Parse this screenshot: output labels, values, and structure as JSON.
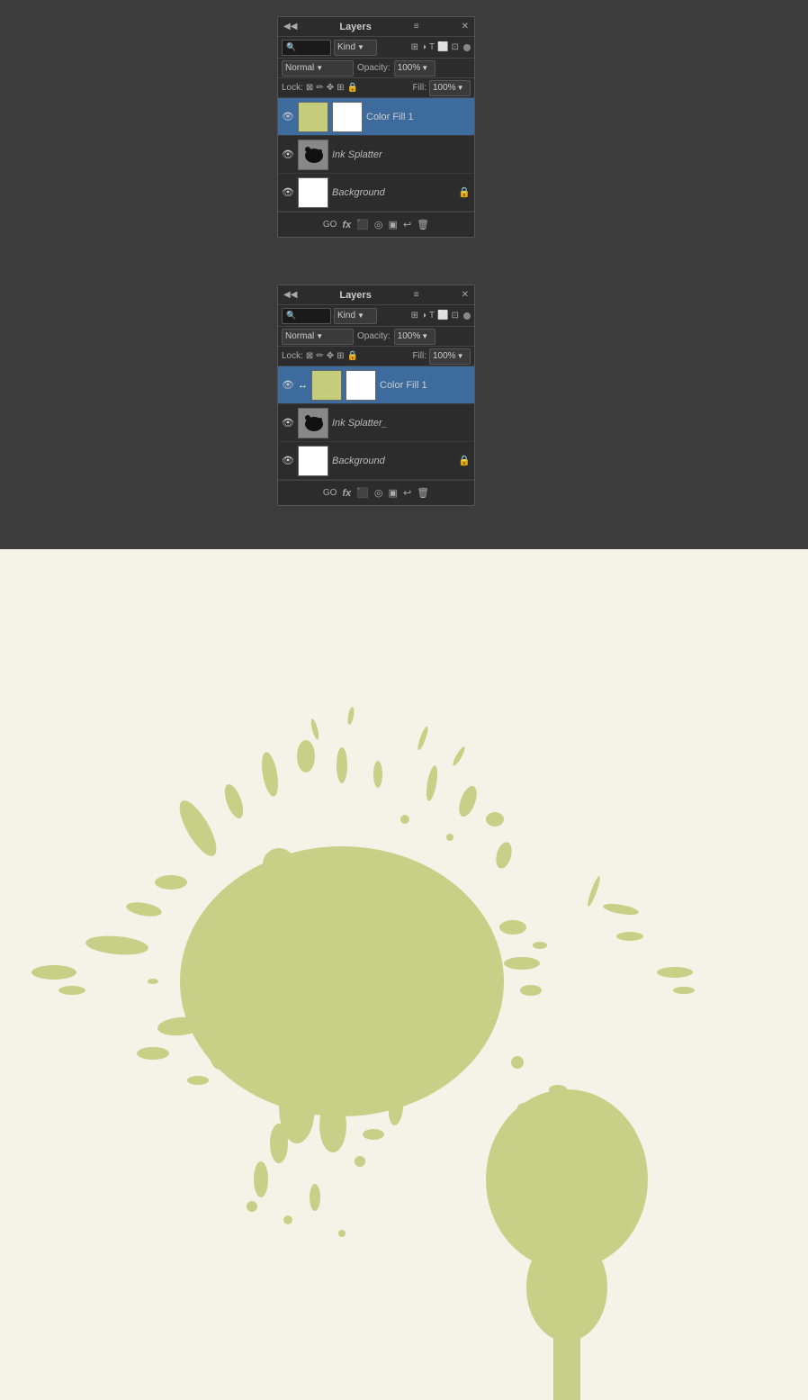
{
  "panel1": {
    "title": "Layers",
    "kind_label": "Kind",
    "blend_mode": "Normal",
    "opacity_label": "Opacity:",
    "opacity_value": "100%",
    "lock_label": "Lock:",
    "fill_label": "Fill:",
    "fill_value": "100%",
    "layers": [
      {
        "name": "Color Fill 1",
        "type": "fill",
        "active": true
      },
      {
        "name": "Ink Splatter",
        "type": "image",
        "active": false
      },
      {
        "name": "Background",
        "type": "background",
        "active": false,
        "locked": true
      }
    ]
  },
  "panel2": {
    "title": "Layers",
    "kind_label": "Kind",
    "blend_mode": "Normal",
    "opacity_label": "Opacity:",
    "opacity_value": "100%",
    "lock_label": "Lock:",
    "fill_label": "Fill:",
    "fill_value": "100%",
    "layers": [
      {
        "name": "Color Fill 1",
        "type": "fill",
        "active": true
      },
      {
        "name": "Ink Splatter_",
        "type": "image",
        "active": false
      },
      {
        "name": "Background",
        "type": "background",
        "active": false,
        "locked": true
      }
    ]
  },
  "bottom_icons": [
    "GO",
    "fx",
    "●",
    "◎",
    "□",
    "↩",
    "🗑"
  ]
}
